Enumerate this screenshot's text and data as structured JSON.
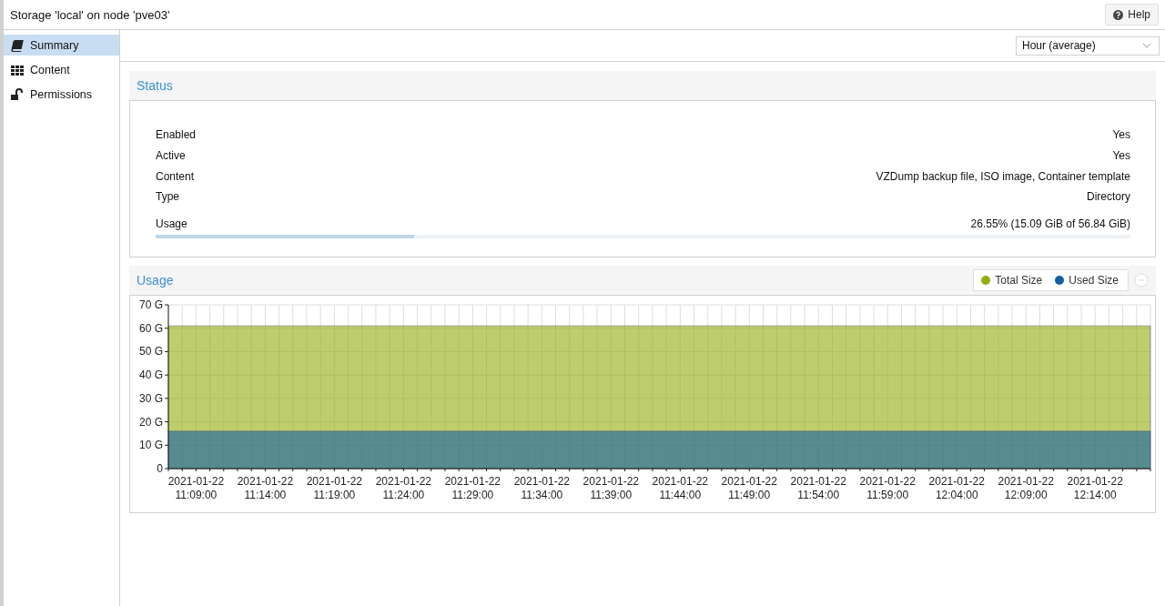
{
  "header": {
    "title": "Storage 'local' on node 'pve03'",
    "help_button": "Help"
  },
  "sidebar": {
    "items": [
      {
        "label": "Summary",
        "kind": "book",
        "selected": true
      },
      {
        "label": "Content",
        "kind": "grid",
        "selected": false
      },
      {
        "label": "Permissions",
        "kind": "lock",
        "selected": false
      }
    ]
  },
  "toolbar": {
    "timeframe": "Hour (average)"
  },
  "status": {
    "title": "Status",
    "rows": [
      {
        "label": "Enabled",
        "value": "Yes"
      },
      {
        "label": "Active",
        "value": "Yes"
      },
      {
        "label": "Content",
        "value": "VZDump backup file, ISO image, Container template"
      },
      {
        "label": "Type",
        "value": "Directory"
      }
    ],
    "usage": {
      "label": "Usage",
      "value": "26.55% (15.09 GiB of 56.84 GiB)",
      "level": 0.2655
    }
  },
  "usage_panel": {
    "title": "Usage",
    "chart_data": {
      "type": "area",
      "grid": true,
      "categories": [
        null,
        null,
        "2021-01-22 11:09:00",
        null,
        null,
        null,
        null,
        "2021-01-22 11:14:00",
        null,
        null,
        null,
        null,
        "2021-01-22 11:19:00",
        null,
        null,
        null,
        null,
        "2021-01-22 11:24:00",
        null,
        null,
        null,
        null,
        "2021-01-22 11:29:00",
        null,
        null,
        null,
        null,
        "2021-01-22 11:34:00",
        null,
        null,
        null,
        null,
        "2021-01-22 11:39:00",
        null,
        null,
        null,
        null,
        "2021-01-22 11:44:00",
        null,
        null,
        null,
        null,
        "2021-01-22 11:49:00",
        null,
        null,
        null,
        null,
        "2021-01-22 11:54:00",
        null,
        null,
        null,
        null,
        "2021-01-22 11:59:00",
        null,
        null,
        null,
        null,
        "2021-01-22 12:04:00",
        null,
        null,
        null,
        null,
        "2021-01-22 12:09:00",
        null,
        null,
        null,
        null,
        "2021-01-22 12:14:00",
        null,
        null,
        null,
        null
      ],
      "series": [
        {
          "name": "Total Size",
          "color": "#94ae0a",
          "values": [
            61,
            61,
            61,
            61,
            61,
            61,
            61,
            61,
            61,
            61,
            61,
            61,
            61,
            61,
            61,
            61,
            61,
            61,
            61,
            61,
            61,
            61,
            61,
            61,
            61,
            61,
            61,
            61,
            61,
            61,
            61,
            61,
            61,
            61,
            61,
            61,
            61,
            61,
            61,
            61,
            61,
            61,
            61,
            61,
            61,
            61,
            61,
            61,
            61,
            61,
            61,
            61,
            61,
            61,
            61,
            61,
            61,
            61,
            61,
            61,
            61,
            61,
            61,
            61,
            61,
            61,
            61,
            61,
            61,
            61,
            61,
            61
          ]
        },
        {
          "name": "Used Size",
          "color": "#115fa6",
          "values": [
            16,
            16,
            16,
            16,
            16,
            16,
            16,
            16,
            16,
            16,
            16,
            16,
            16,
            16,
            16,
            16,
            16,
            16,
            16,
            16,
            16,
            16,
            16,
            16,
            16,
            16,
            16,
            16,
            16,
            16,
            16,
            16,
            16,
            16,
            16,
            16,
            16,
            16,
            16,
            16,
            16,
            16,
            16,
            16,
            16,
            16,
            16,
            16,
            16,
            16,
            16,
            16,
            16,
            16,
            16,
            16,
            16,
            16,
            16,
            16,
            16,
            16,
            16,
            16,
            16,
            16,
            16,
            16,
            16,
            16,
            16,
            16
          ]
        }
      ],
      "ylim": [
        0,
        70
      ],
      "yticks": [
        {
          "value": 0,
          "label": "0"
        },
        {
          "value": 10,
          "label": "10 G"
        },
        {
          "value": 20,
          "label": "20 G"
        },
        {
          "value": 30,
          "label": "30 G"
        },
        {
          "value": 40,
          "label": "40 G"
        },
        {
          "value": 50,
          "label": "50 G"
        },
        {
          "value": 60,
          "label": "60 G"
        },
        {
          "value": 70,
          "label": "70 G"
        }
      ]
    }
  }
}
